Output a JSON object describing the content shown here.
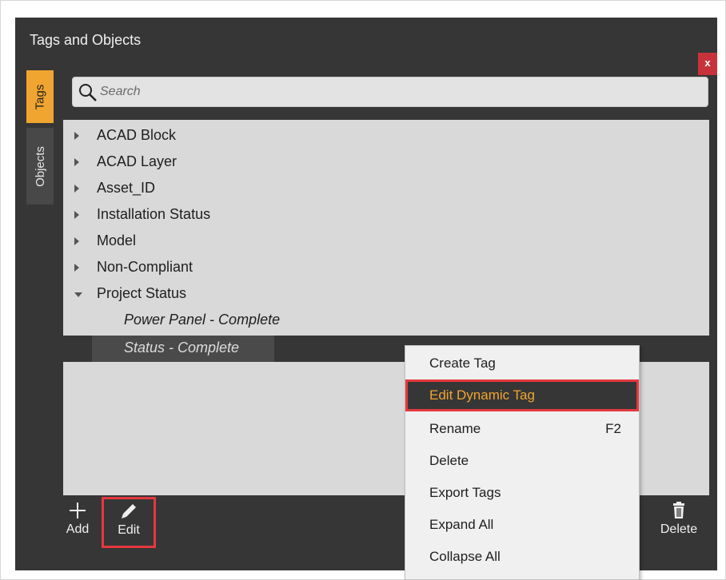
{
  "window": {
    "title": "Tags and Objects",
    "close_label": "x"
  },
  "side_tabs": [
    {
      "label": "Tags",
      "active": true
    },
    {
      "label": "Objects",
      "active": false
    }
  ],
  "search": {
    "placeholder": "Search",
    "value": ""
  },
  "tree": {
    "items": [
      {
        "label": "ACAD Block",
        "expanded": false
      },
      {
        "label": "ACAD Layer",
        "expanded": false
      },
      {
        "label": "Asset_ID",
        "expanded": false
      },
      {
        "label": "Installation Status",
        "expanded": false
      },
      {
        "label": "Model",
        "expanded": false
      },
      {
        "label": "Non-Compliant",
        "expanded": false
      },
      {
        "label": "Project Status",
        "expanded": true
      }
    ],
    "children": [
      {
        "label": "Power Panel - Complete",
        "selected": false
      },
      {
        "label": "Status - Complete",
        "selected": true
      }
    ]
  },
  "toolbar": {
    "add_label": "Add",
    "edit_label": "Edit",
    "delete_label": "Delete"
  },
  "context_menu": {
    "items": [
      {
        "label": "Create Tag",
        "shortcut": ""
      },
      {
        "label": "Edit Dynamic Tag",
        "shortcut": "",
        "highlighted": true
      },
      {
        "label": "Rename",
        "shortcut": "F2"
      },
      {
        "label": "Delete",
        "shortcut": ""
      },
      {
        "label": "Export Tags",
        "shortcut": ""
      },
      {
        "label": "Expand All",
        "shortcut": ""
      },
      {
        "label": "Collapse All",
        "shortcut": ""
      }
    ]
  },
  "colors": {
    "panel_bg": "#363636",
    "accent_orange": "#f0a530",
    "highlight_red": "#e5383f",
    "close_red": "#c8333b",
    "tree_bg": "#d9d9d9"
  },
  "icons": [
    "search-icon",
    "plus-icon",
    "pencil-icon",
    "trash-icon",
    "caret-right-icon",
    "caret-down-icon"
  ]
}
